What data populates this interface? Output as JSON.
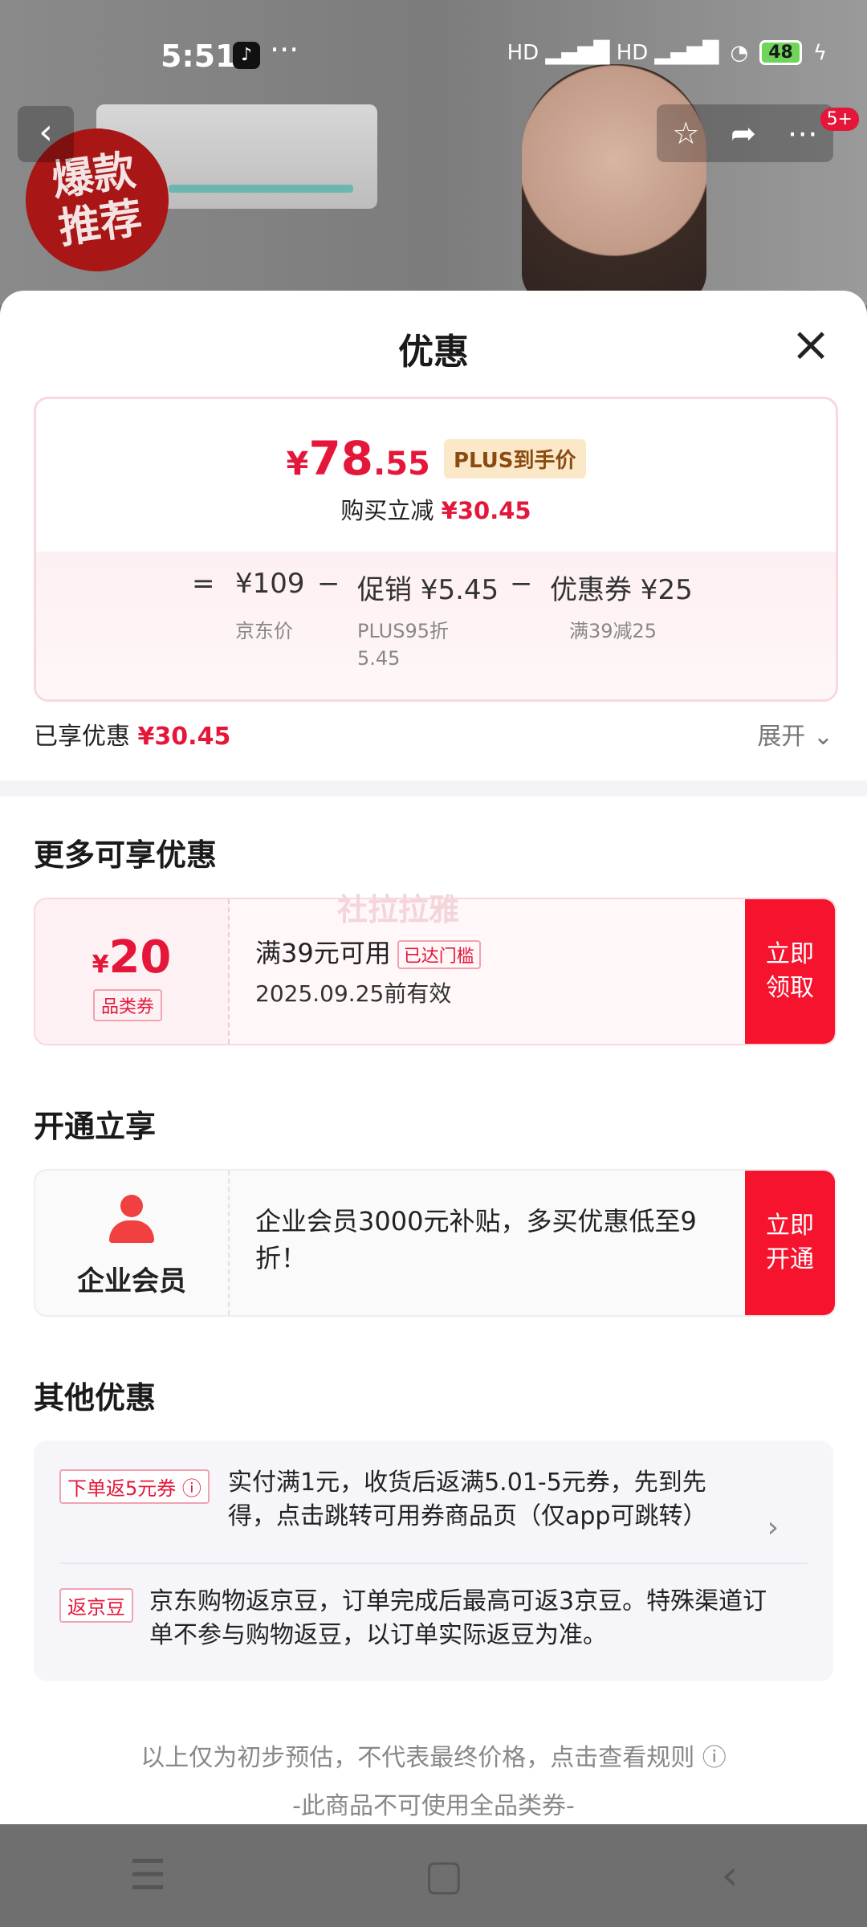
{
  "status_bar": {
    "time": "5:51",
    "app_icon": "tiktok-icon",
    "dots": "···",
    "signal": "HD ▂▄▆█  HD ▂▄▆█",
    "battery": "48"
  },
  "product_bg": {
    "badge_text": "爆款\n推荐",
    "notification_count": "5+"
  },
  "sheet": {
    "title": "优惠",
    "close_icon": "×"
  },
  "price": {
    "currency": "¥",
    "integer": "78",
    "decimal": ".55",
    "plus_tag": "PLUS到手价",
    "reduce_label": "购买立减",
    "reduce_value": "¥30.45"
  },
  "formula": {
    "eq": "=",
    "jd_price": "¥109",
    "minus1": "−",
    "promo": "促销 ¥5.45",
    "minus2": "−",
    "coupon": "优惠券 ¥25",
    "jd_price_label": "京东价",
    "promo_sub": "PLUS95折\n5.45",
    "coupon_sub": "满39减25"
  },
  "enjoyed": {
    "label": "已享优惠",
    "value": "¥30.45",
    "expand": "展开 ⌄"
  },
  "more": {
    "title": "更多可享优惠",
    "coupon_currency": "¥",
    "coupon_amount": "20",
    "coupon_type": "品类券",
    "coupon_condition": "满39元可用",
    "coupon_tag": "已达门槛",
    "coupon_valid": "2025.09.25前有效",
    "button": "立即\n领取",
    "watermark": "社拉拉雅"
  },
  "open": {
    "title": "开通立享",
    "member_label": "企业会员",
    "member_text": "企业会员3000元补贴，多买优惠低至9折！",
    "button": "立即\n开通"
  },
  "other": {
    "title": "其他优惠",
    "row1_tag": "下单返5元券 ⓘ",
    "row1_text": "实付满1元，收货后返满5.01-5元券，先到先得，点击跳转可用券商品页（仅app可跳转）",
    "row2_tag": "返京豆",
    "row2_text": "京东购物返京豆，订单完成后最高可返3京豆。特殊渠道订单不参与购物返豆，以订单实际返豆为准。"
  },
  "footer": {
    "note": "以上仅为初步预估，不代表最终价格，点击查看规则 ⓘ",
    "note2": "-此商品不可使用全品类券-"
  },
  "sys_nav": {
    "menu": "☰",
    "home": "▢",
    "back": "‹"
  }
}
